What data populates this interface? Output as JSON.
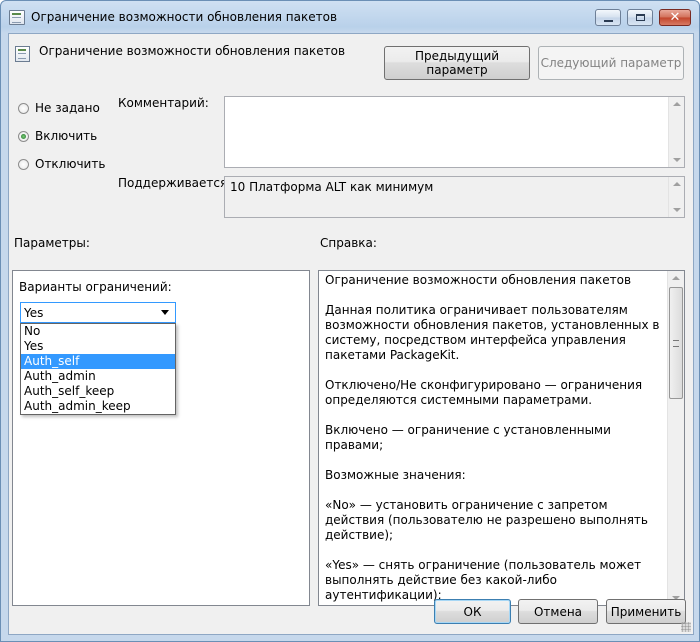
{
  "window": {
    "title": "Ограничение возможности обновления пакетов",
    "close_glyph": "✕"
  },
  "header": {
    "policy_title": "Ограничение возможности обновления пакетов",
    "prev_button": "Предыдущий параметр",
    "next_button": "Следующий параметр"
  },
  "state": {
    "options": [
      "Не задано",
      "Включить",
      "Отключить"
    ],
    "selected": "Включить"
  },
  "comment": {
    "label": "Комментарий:",
    "value": ""
  },
  "supported": {
    "label": "Поддерживается:",
    "value": "10 Платформа ALT как минимум"
  },
  "sections": {
    "params_label": "Параметры:",
    "help_label": "Справка:"
  },
  "params": {
    "combo_label": "Варианты ограничений:",
    "combo_value": "Yes",
    "options": [
      "No",
      "Yes",
      "Auth_self",
      "Auth_admin",
      "Auth_self_keep",
      "Auth_admin_keep"
    ],
    "highlighted": "Auth_self"
  },
  "help": {
    "text": "Ограничение возможности обновления пакетов\n\nДанная политика ограничивает пользователям возможности обновления пакетов, установленных в систему, посредством интерфейса управления пакетами PackageKit.\n\nОтключено/Не сконфигурировано — ограничения определяются системными параметрами.\n\nВключено — ограничение с установленными правами;\n\nВозможные значения:\n\n«No» — установить ограничение с запретом действия (пользователю не разрешено выполнять действие);\n\n«Yes» — снять ограничение (пользователь может выполнять действие без какой-либо аутентификации);\n\n«Auth_self» — пользователь должен ввести свой пароль для"
  },
  "footer": {
    "ok": "ОК",
    "cancel": "Отмена",
    "apply": "Применить"
  },
  "icons": {
    "title": "policy-settings-icon",
    "header": "policy-settings-icon"
  },
  "colors": {
    "selection": "#3399ff",
    "default_button_border": "#3c7fb1",
    "radio_checked": "#1f6b25"
  }
}
